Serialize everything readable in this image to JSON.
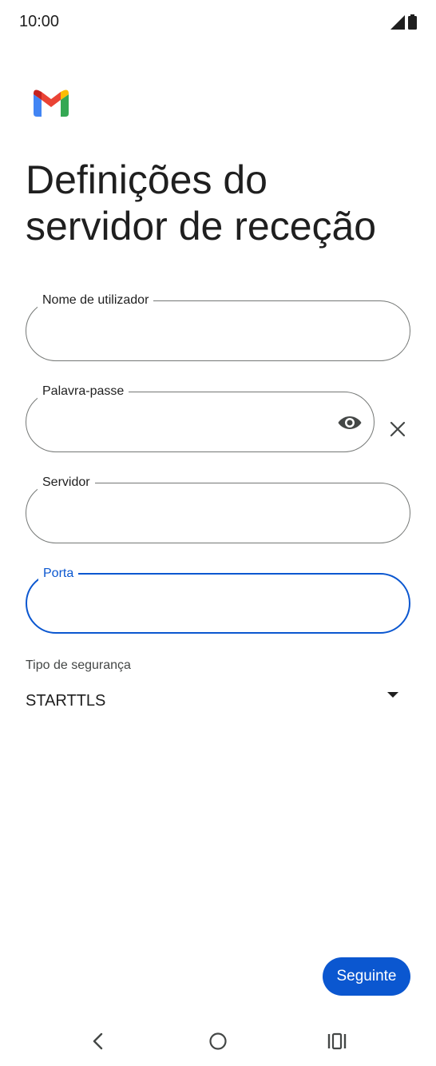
{
  "status_bar": {
    "time": "10:00",
    "icons": [
      "signal-icon",
      "battery-icon"
    ]
  },
  "app": {
    "logo": "gmail-logo"
  },
  "page": {
    "title": "Definições do servidor de receção"
  },
  "form": {
    "username": {
      "label": "Nome de utilizador",
      "value": ""
    },
    "password": {
      "label": "Palavra-passe",
      "value": "",
      "icons": [
        "eye-icon",
        "close-icon"
      ]
    },
    "server": {
      "label": "Servidor",
      "value": ""
    },
    "port": {
      "label": "Porta",
      "value": ""
    },
    "security": {
      "label": "Tipo de segurança",
      "selected": "STARTTLS"
    }
  },
  "actions": {
    "next_label": "Seguinte"
  },
  "colors": {
    "accent": "#0b57d0",
    "text": "#1f1f1f",
    "outline": "#747775"
  },
  "navigation": {
    "icons": [
      "back-icon",
      "home-icon",
      "recents-icon"
    ]
  }
}
